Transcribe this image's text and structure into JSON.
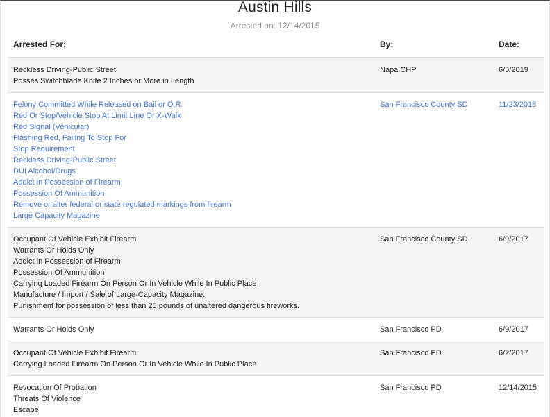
{
  "person": {
    "name": "Austin Hills",
    "arrested_on": "Arrested on: 12/14/2015"
  },
  "table": {
    "headers": {
      "arrested_for": "Arrested For:",
      "by": "By:",
      "date": "Date:"
    },
    "rows": [
      {
        "charges": [
          "Reckless Driving-Public Street",
          "Posses Switchblade Knife 2 Inches or More in Length"
        ],
        "by": "Napa CHP",
        "date": "6/5/2019",
        "linked": false,
        "shaded": true
      },
      {
        "charges": [
          "Felony Committed While Released on Bail or O.R.",
          "Red Or Stop/Vehicle Stop At Limit Line Or X-Walk",
          "Red Signal (Vehicular)",
          "Flashing Red, Failing To Stop For",
          "Stop Requirement",
          "Reckless Driving-Public Street",
          "DUI Alcohol/Drugs",
          "Addict in Possession of Firearm",
          "Possession Of Ammunition",
          "Remove or alter federal or state regulated markings from firearm",
          "Large Capacity Magazine"
        ],
        "by": "San Francisco County SD",
        "date": "11/23/2018",
        "linked": true,
        "shaded": false
      },
      {
        "charges": [
          "Occupant Of Vehicle Exhibit Firearm",
          "Warrants Or Holds Only",
          "Addict in Possession of Firearm",
          "Possession Of Ammunition",
          "Carrying Loaded Firearm On Person Or In Vehicle While In Public Place",
          "Manufacture / Import / Sale of Large-Capacity Magazine.",
          "Punishment for possession of less than 25 pounds of unaltered dangerous fireworks."
        ],
        "by": "San Francisco County SD",
        "date": "6/9/2017",
        "linked": false,
        "shaded": true
      },
      {
        "charges": [
          "Warrants Or Holds Only"
        ],
        "by": "San Francisco PD",
        "date": "6/9/2017",
        "linked": false,
        "shaded": false
      },
      {
        "charges": [
          "Occupant Of Vehicle Exhibit Firearm",
          "Carrying Loaded Firearm On Person Or In Vehicle While In Public Place"
        ],
        "by": "San Francisco PD",
        "date": "6/2/2017",
        "linked": false,
        "shaded": true
      },
      {
        "charges": [
          "Revocation Of Probation",
          "Threats Of Violence",
          "Escape"
        ],
        "by": "San Francisco PD",
        "date": "12/14/2015",
        "linked": false,
        "shaded": false
      }
    ]
  },
  "colors": {
    "link": "#3f73c4",
    "row_shade": "#f4f4f4",
    "border": "#dcdcdc",
    "muted_text": "#8c8c8c"
  }
}
